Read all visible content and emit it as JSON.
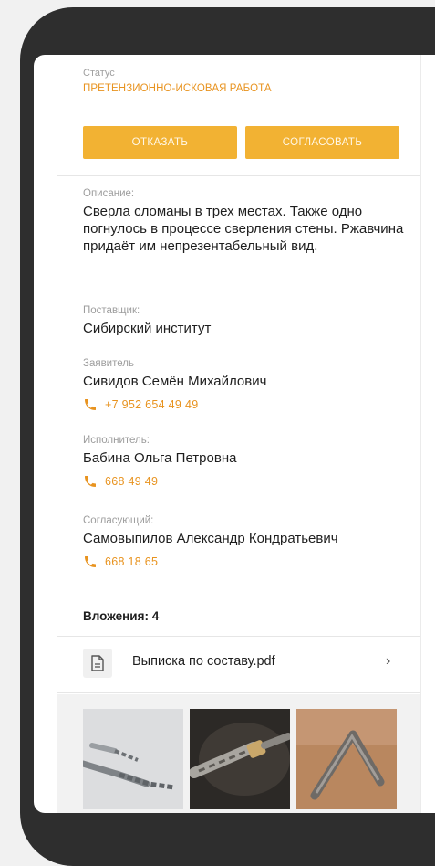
{
  "status": {
    "label": "Статус",
    "value": "ПРЕТЕНЗИОННО-ИСКОВАЯ РАБОТА"
  },
  "actions": {
    "reject_label": "ОТКАЗАТЬ",
    "approve_label": "СОГЛАСОВАТЬ"
  },
  "description": {
    "label": "Описание:",
    "text": "Сверла сломаны в трех местах. Также одно погнулось в процессе сверления стены. Ржавчина придаёт им непрезентабельный вид."
  },
  "supplier": {
    "label": "Поставщик:",
    "value": "Сибирский институт"
  },
  "applicant": {
    "label": "Заявитель",
    "name": "Сивидов Семён Михайлович",
    "phone": "+7 952 654 49 49"
  },
  "executor": {
    "label": "Исполнитель:",
    "name": "Бабина Ольга Петровна",
    "phone": "668 49 49"
  },
  "approver": {
    "label": "Согласующий:",
    "name": "Самовыпилов Александр Кондратьевич",
    "phone": "668 18 65"
  },
  "attachments": {
    "title": "Вложения: 4",
    "file_name": "Выписка по составу.pdf",
    "photos": [
      "drill-bits-photo",
      "broken-drill-photo",
      "bent-drill-photo"
    ]
  },
  "colors": {
    "accent": "#f2b233",
    "accent_text": "#e8931f",
    "frame": "#2e2e2e"
  }
}
